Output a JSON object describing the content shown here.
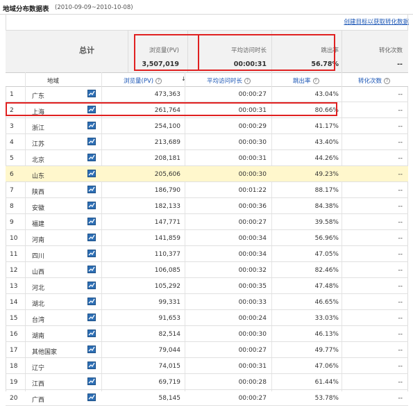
{
  "header": {
    "title": "地域分布数据表",
    "date_range": "(2010-09-09~2010-10-08)"
  },
  "create_goal_link": "创建目标以获取转化数据",
  "totals": {
    "label": "总计",
    "pv_label": "浏览量(PV)",
    "pv_value": "3,507,019",
    "time_label": "平均访问时长",
    "time_value": "00:00:31",
    "bounce_label": "跳出率",
    "bounce_value": "56.78%",
    "conv_label": "转化次数",
    "conv_value": "--"
  },
  "columns": {
    "region": "地域",
    "pv": "浏览量(PV)",
    "time": "平均访问时长",
    "bounce": "跳出率",
    "conv": "转化次数",
    "help": "?",
    "sort": "↓"
  },
  "rows": [
    {
      "idx": "1",
      "region": "广东",
      "pv": "473,363",
      "time": "00:00:27",
      "bounce": "43.04%",
      "conv": "--"
    },
    {
      "idx": "2",
      "region": "上海",
      "pv": "261,764",
      "time": "00:00:31",
      "bounce": "80.66%",
      "conv": "--"
    },
    {
      "idx": "3",
      "region": "浙江",
      "pv": "254,100",
      "time": "00:00:29",
      "bounce": "41.17%",
      "conv": "--"
    },
    {
      "idx": "4",
      "region": "江苏",
      "pv": "213,689",
      "time": "00:00:30",
      "bounce": "43.40%",
      "conv": "--"
    },
    {
      "idx": "5",
      "region": "北京",
      "pv": "208,181",
      "time": "00:00:31",
      "bounce": "44.26%",
      "conv": "--"
    },
    {
      "idx": "6",
      "region": "山东",
      "pv": "205,606",
      "time": "00:00:30",
      "bounce": "49.23%",
      "conv": "--"
    },
    {
      "idx": "7",
      "region": "陕西",
      "pv": "186,790",
      "time": "00:01:22",
      "bounce": "88.17%",
      "conv": "--"
    },
    {
      "idx": "8",
      "region": "安徽",
      "pv": "182,133",
      "time": "00:00:36",
      "bounce": "84.38%",
      "conv": "--"
    },
    {
      "idx": "9",
      "region": "福建",
      "pv": "147,771",
      "time": "00:00:27",
      "bounce": "39.58%",
      "conv": "--"
    },
    {
      "idx": "10",
      "region": "河南",
      "pv": "141,859",
      "time": "00:00:34",
      "bounce": "56.96%",
      "conv": "--"
    },
    {
      "idx": "11",
      "region": "四川",
      "pv": "110,377",
      "time": "00:00:34",
      "bounce": "47.05%",
      "conv": "--"
    },
    {
      "idx": "12",
      "region": "山西",
      "pv": "106,085",
      "time": "00:00:32",
      "bounce": "82.46%",
      "conv": "--"
    },
    {
      "idx": "13",
      "region": "河北",
      "pv": "105,292",
      "time": "00:00:35",
      "bounce": "47.48%",
      "conv": "--"
    },
    {
      "idx": "14",
      "region": "湖北",
      "pv": "99,331",
      "time": "00:00:33",
      "bounce": "46.65%",
      "conv": "--"
    },
    {
      "idx": "15",
      "region": "台湾",
      "pv": "91,653",
      "time": "00:00:24",
      "bounce": "33.03%",
      "conv": "--"
    },
    {
      "idx": "16",
      "region": "湖南",
      "pv": "82,514",
      "time": "00:00:30",
      "bounce": "46.13%",
      "conv": "--"
    },
    {
      "idx": "17",
      "region": "其他国家",
      "pv": "79,044",
      "time": "00:00:27",
      "bounce": "49.77%",
      "conv": "--"
    },
    {
      "idx": "18",
      "region": "辽宁",
      "pv": "74,015",
      "time": "00:00:31",
      "bounce": "47.06%",
      "conv": "--"
    },
    {
      "idx": "19",
      "region": "江西",
      "pv": "69,719",
      "time": "00:00:28",
      "bounce": "61.44%",
      "conv": "--"
    },
    {
      "idx": "20",
      "region": "广西",
      "pv": "58,145",
      "time": "00:00:27",
      "bounce": "53.78%",
      "conv": "--"
    }
  ],
  "highlighted_row": "6",
  "colors": {
    "accent": "#1a55b5",
    "highlight": "#fff7cc",
    "annotation": "#e02020",
    "chart_icon": "#2e6fb5"
  },
  "icons": {
    "trend": "line-chart-icon",
    "help": "question-circle-icon",
    "sort": "sort-desc-arrow"
  }
}
